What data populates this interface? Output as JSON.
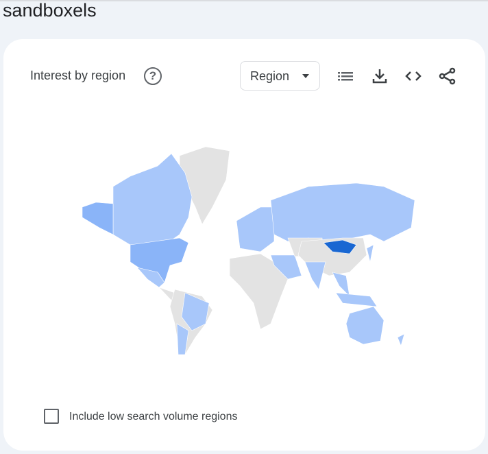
{
  "search_term": "sandboxels",
  "card": {
    "title": "Interest by region",
    "region_select": "Region",
    "low_volume_label": "Include low search volume regions"
  },
  "colors": {
    "no_data": "#e3e3e3",
    "low": "#a8c7fa",
    "medium": "#8ab4f8",
    "high": "#1967d2"
  },
  "icons": [
    "help-icon",
    "list-icon",
    "download-icon",
    "embed-icon",
    "share-icon"
  ]
}
